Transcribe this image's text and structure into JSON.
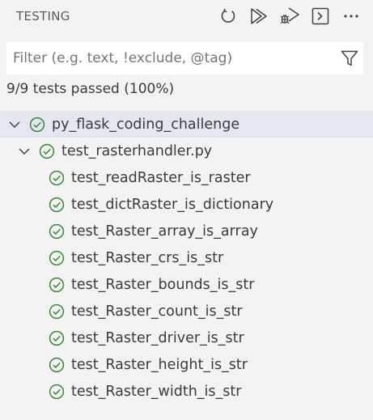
{
  "header": {
    "title": "TESTING"
  },
  "filter": {
    "placeholder": "Filter (e.g. text, !exclude, @tag)",
    "value": ""
  },
  "summary": {
    "text": "9/9 tests passed (100%)"
  },
  "tree": {
    "workspace": {
      "label": "py_flask_coding_challenge",
      "status": "passed",
      "expanded": true
    },
    "file": {
      "label": "test_rasterhandler.py",
      "status": "passed",
      "expanded": true
    },
    "tests": [
      {
        "label": "test_readRaster_is_raster",
        "status": "passed"
      },
      {
        "label": "test_dictRaster_is_dictionary",
        "status": "passed"
      },
      {
        "label": "test_Raster_array_is_array",
        "status": "passed"
      },
      {
        "label": "test_Raster_crs_is_str",
        "status": "passed"
      },
      {
        "label": "test_Raster_bounds_is_str",
        "status": "passed"
      },
      {
        "label": "test_Raster_count_is_str",
        "status": "passed"
      },
      {
        "label": "test_Raster_driver_is_str",
        "status": "passed"
      },
      {
        "label": "test_Raster_height_is_str",
        "status": "passed"
      },
      {
        "label": "test_Raster_width_is_str",
        "status": "passed"
      }
    ]
  },
  "colors": {
    "pass": "#388a34",
    "icon": "#424242",
    "selection": "#e4e6f1",
    "background": "#f3f3f3"
  },
  "icons": {
    "refresh": "refresh-icon",
    "run_all": "run-all-icon",
    "debug_all": "debug-all-icon",
    "show_output": "terminal-icon",
    "more": "more-icon",
    "filter": "filter-icon",
    "chevron": "chevron-down-icon",
    "pass": "pass-check-icon"
  }
}
